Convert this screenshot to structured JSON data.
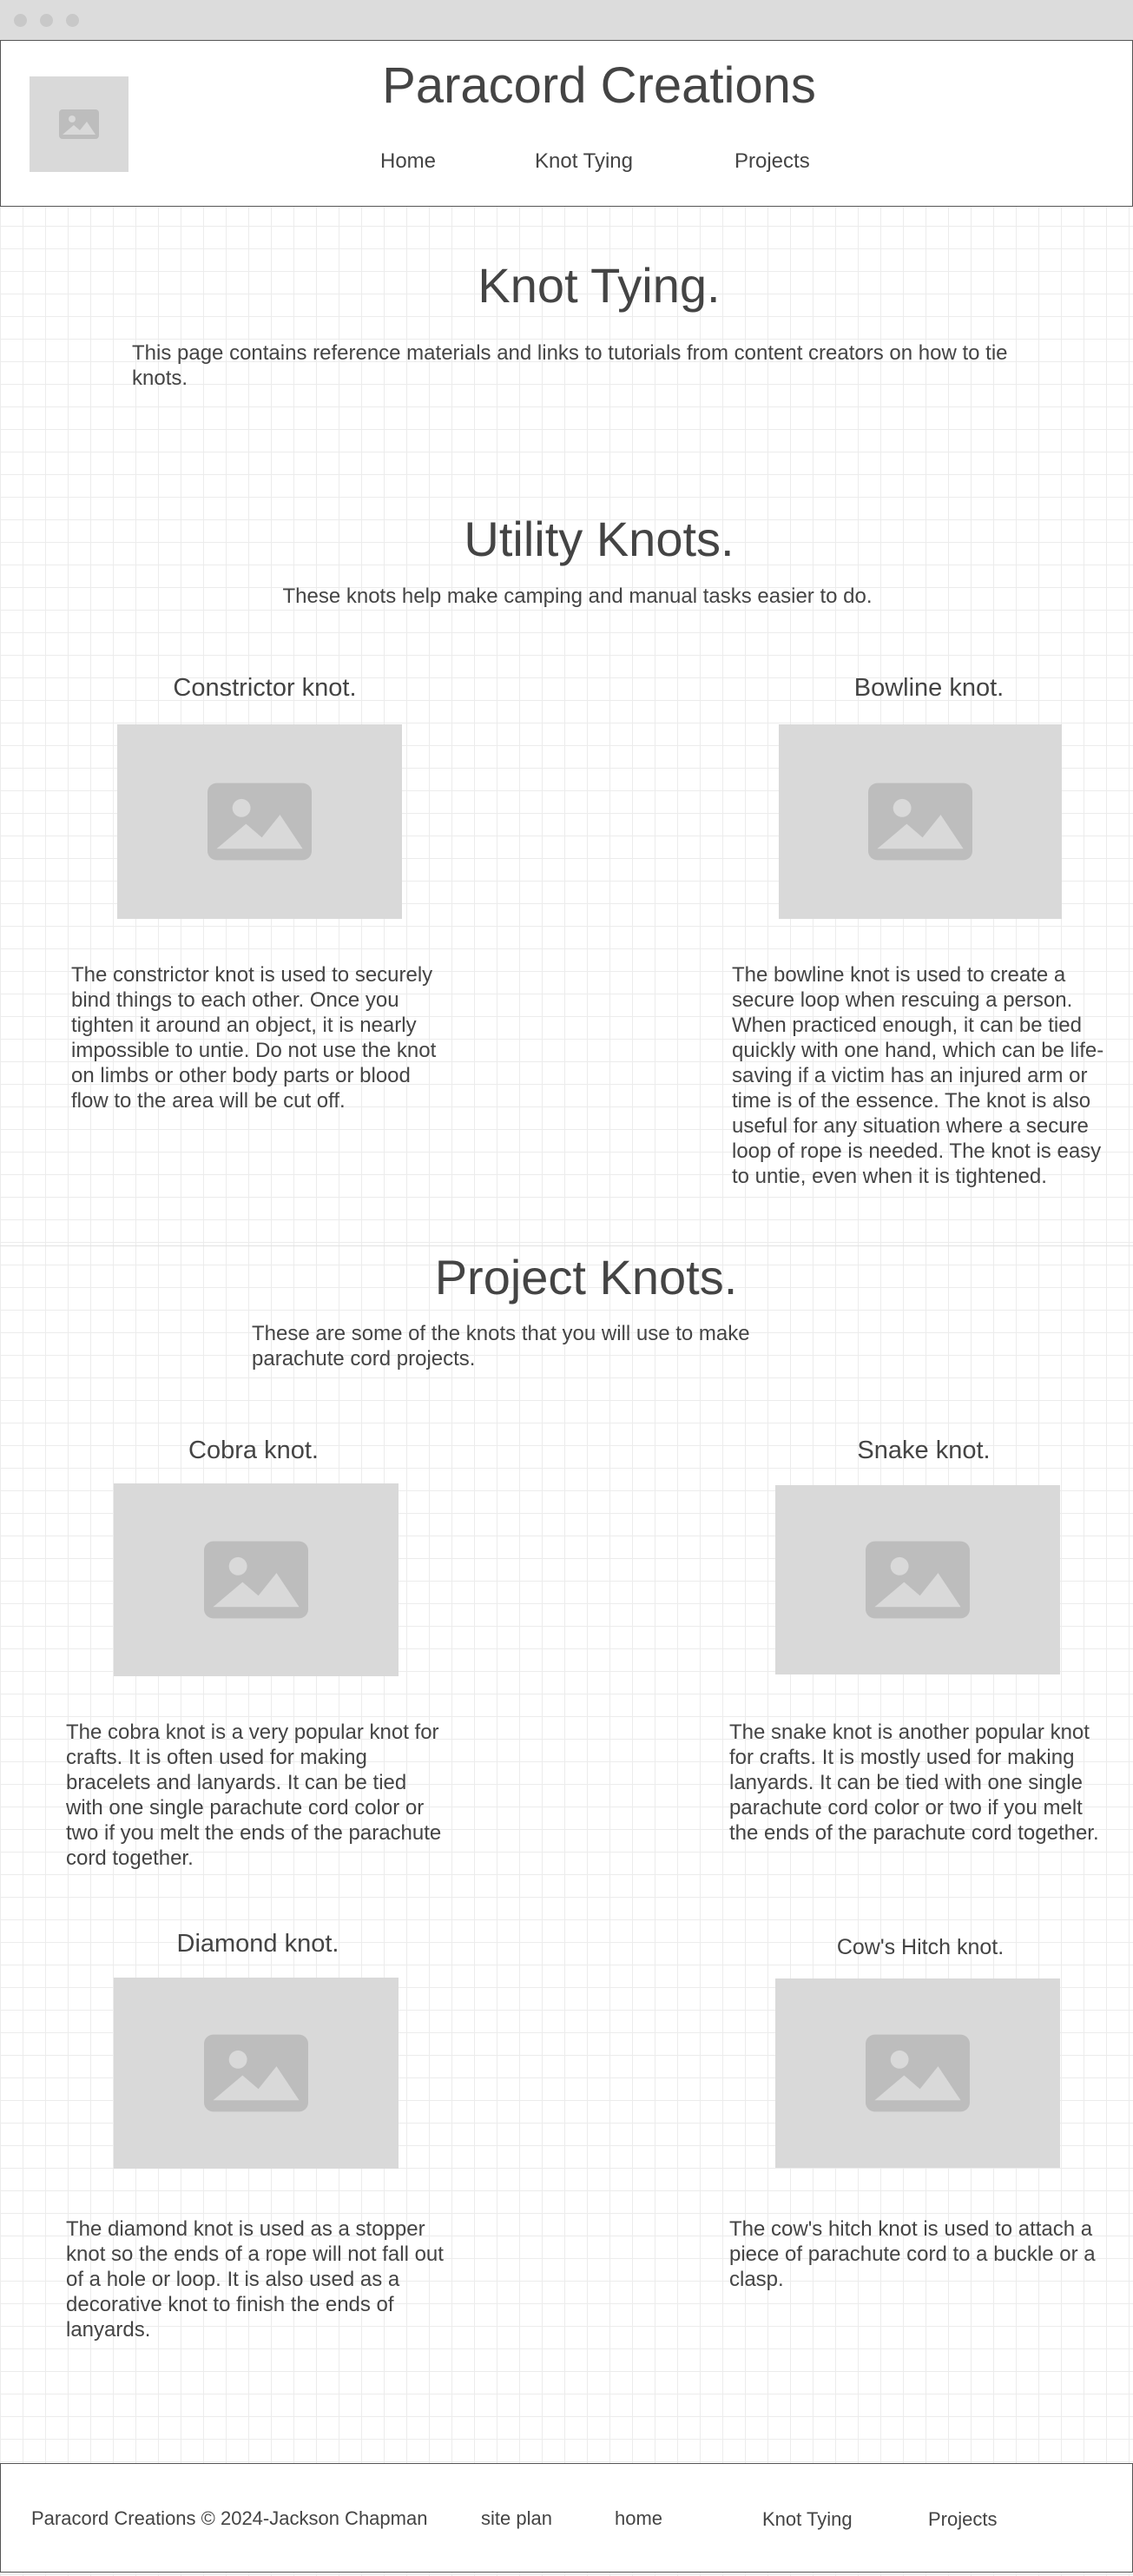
{
  "header": {
    "site_title": "Paracord Creations",
    "logo_icon": "image-placeholder-icon",
    "nav": [
      "Home",
      "Knot Tying",
      "Projects"
    ]
  },
  "intro": {
    "heading": "Knot Tying.",
    "text": "This page contains reference materials and links to tutorials from content creators on how to tie knots."
  },
  "utility": {
    "heading": "Utility Knots.",
    "subtext": "These knots help make camping and manual tasks easier to do.",
    "knots": [
      {
        "title": "Constrictor knot.",
        "image_icon": "image-placeholder-icon",
        "description": "The constrictor knot is used to securely bind things to each other. Once you tighten it around an object, it is nearly impossible to untie. Do not use the knot on limbs or other body parts or blood flow to the area will be cut off."
      },
      {
        "title": "Bowline knot.",
        "image_icon": "image-placeholder-icon",
        "description": "The bowline knot is used to create a secure loop when rescuing a person. When practiced enough, it can be tied quickly with one hand, which can be life-saving if a victim has an injured arm or time is of the essence. The knot is also useful for any situation where a secure loop of rope is needed. The knot  is easy to untie, even when it is tightened."
      }
    ]
  },
  "project": {
    "heading": "Project Knots.",
    "subtext": "These are some of the knots that you will use to make parachute cord projects.",
    "knots": [
      {
        "title": "Cobra knot.",
        "image_icon": "image-placeholder-icon",
        "description": "The cobra knot is a very popular knot for crafts. It is often used for making bracelets and lanyards. It can be tied with one single parachute cord color or two if you melt the ends of the parachute cord together."
      },
      {
        "title": "Snake knot.",
        "image_icon": "image-placeholder-icon",
        "description": "The snake knot is another popular knot for crafts. It is mostly used for making lanyards. It can be tied with one single parachute cord color or two if you melt the ends of the parachute cord together."
      },
      {
        "title": "Diamond knot.",
        "image_icon": "image-placeholder-icon",
        "description": "The diamond knot is used as a stopper knot so the ends of a rope will not fall out of a hole or loop. It is also used as a decorative knot to finish the ends of  lanyards."
      },
      {
        "title": "Cow's Hitch knot.",
        "image_icon": "image-placeholder-icon",
        "description": "The cow's hitch knot is used to attach a piece of parachute cord to a buckle or a clasp."
      }
    ]
  },
  "footer": {
    "copyright": "Paracord Creations © 2024-Jackson Chapman",
    "links": [
      "site plan",
      "home",
      "Knot Tying",
      "Projects"
    ]
  },
  "colors": {
    "placeholder": "#d9d9d9",
    "placeholder_icon": "#bdbdbd",
    "text": "#444444",
    "grid": "#ececec"
  }
}
